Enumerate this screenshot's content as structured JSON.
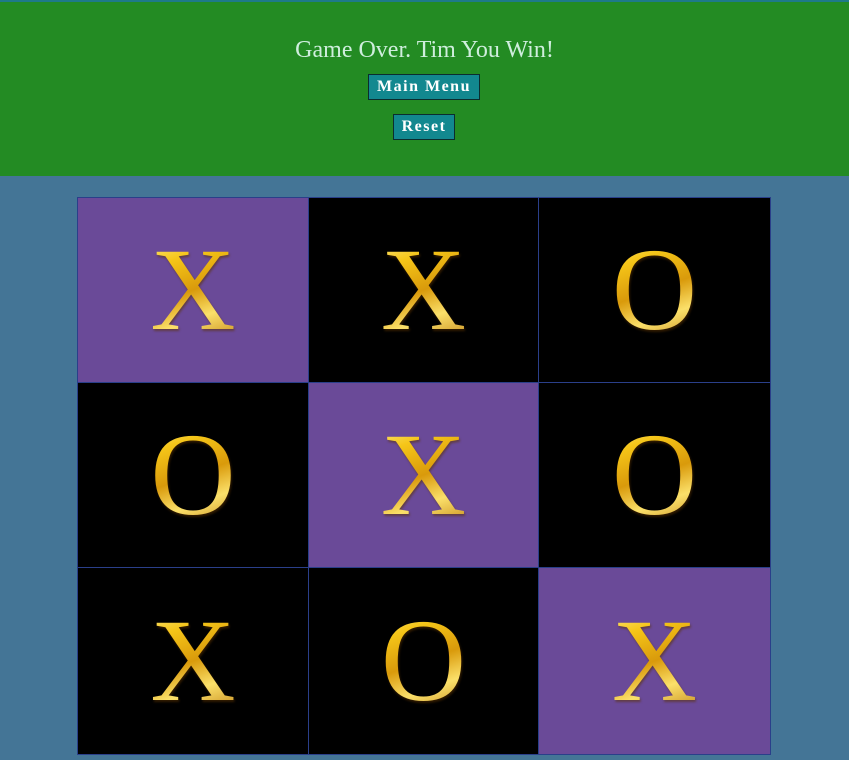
{
  "header": {
    "message": "Game Over. Tim You Win!",
    "main_menu_label": "Main Menu",
    "reset_label": "Reset"
  },
  "colors": {
    "header_bg": "#238b23",
    "page_bg": "#447596",
    "cell_bg": "#000000",
    "winning_cell_bg": "#6a4a98",
    "button_bg": "#12888f",
    "mark_color": "#f5c518"
  },
  "board": {
    "cells": [
      {
        "mark": "X",
        "winning": true
      },
      {
        "mark": "X",
        "winning": false
      },
      {
        "mark": "O",
        "winning": false
      },
      {
        "mark": "O",
        "winning": false
      },
      {
        "mark": "X",
        "winning": true
      },
      {
        "mark": "O",
        "winning": false
      },
      {
        "mark": "X",
        "winning": false
      },
      {
        "mark": "O",
        "winning": false
      },
      {
        "mark": "X",
        "winning": true
      }
    ]
  }
}
